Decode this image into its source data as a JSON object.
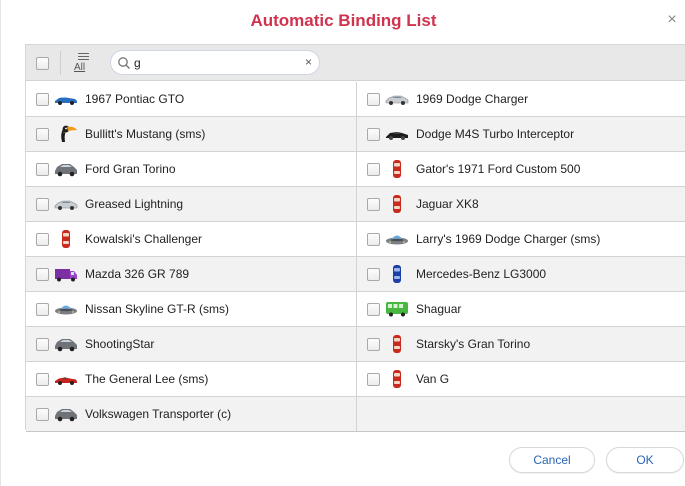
{
  "dialog": {
    "title": "Automatic Binding List",
    "close_label": "×",
    "colors": {
      "title": "#d0334e",
      "button_text": "#2a66b5"
    }
  },
  "toolbar": {
    "all_label": "All",
    "search_value": "g",
    "search_icon": "search-icon",
    "clear_label": "×"
  },
  "items": [
    {
      "label": "1967 Pontiac GTO",
      "icon": "blue-sports-car-icon",
      "checked": false
    },
    {
      "label": "1969 Dodge Charger",
      "icon": "silver-sedan-icon",
      "checked": false
    },
    {
      "label": "Bullitt's Mustang (sms)",
      "icon": "toucan-icon",
      "checked": false
    },
    {
      "label": "Dodge M4S Turbo Interceptor",
      "icon": "black-sports-car-icon",
      "checked": false
    },
    {
      "label": "Ford Gran Torino",
      "icon": "gray-car-icon",
      "checked": false
    },
    {
      "label": "Gator's 1971 Ford Custom 500",
      "icon": "red-car-topdown-icon",
      "checked": false
    },
    {
      "label": "Greased Lightning",
      "icon": "silver-sedan-icon",
      "checked": false
    },
    {
      "label": "Jaguar XK8",
      "icon": "red-car-topdown-icon",
      "checked": false
    },
    {
      "label": "Kowalski's Challenger",
      "icon": "red-car-topdown-icon",
      "checked": false
    },
    {
      "label": "Larry's 1969 Dodge Charger (sms)",
      "icon": "ufo-icon",
      "checked": false
    },
    {
      "label": "Mazda 326 GR 789",
      "icon": "purple-truck-icon",
      "checked": false
    },
    {
      "label": "Mercedes-Benz LG3000",
      "icon": "blue-car-topdown-icon",
      "checked": false
    },
    {
      "label": "Nissan Skyline GT-R (sms)",
      "icon": "ufo-icon",
      "checked": false
    },
    {
      "label": "Shaguar",
      "icon": "green-bus-icon",
      "checked": false
    },
    {
      "label": "ShootingStar",
      "icon": "gray-car-icon",
      "checked": false
    },
    {
      "label": "Starsky's Gran Torino",
      "icon": "red-car-topdown-icon",
      "checked": false
    },
    {
      "label": "The General Lee (sms)",
      "icon": "red-sports-car-icon",
      "checked": false
    },
    {
      "label": "Van G",
      "icon": "red-car-topdown-icon",
      "checked": false
    },
    {
      "label": "Volkswagen Transporter (c)",
      "icon": "gray-car-icon",
      "checked": false
    }
  ],
  "footer": {
    "cancel_label": "Cancel",
    "ok_label": "OK"
  }
}
